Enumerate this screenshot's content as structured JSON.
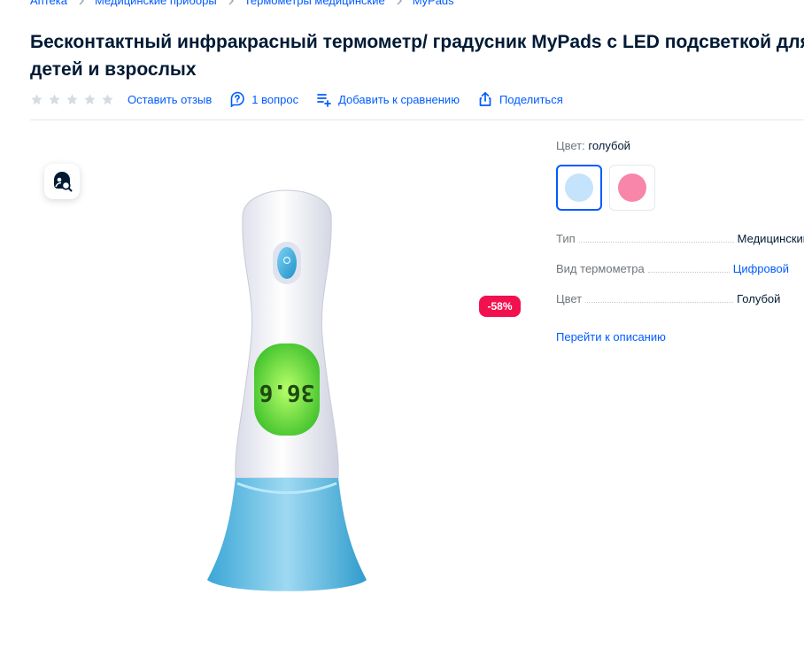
{
  "breadcrumbs": [
    "Аптека",
    "Медицинские приборы",
    "Термометры медицинские",
    "MyPads"
  ],
  "title": "Бесконтактный инфракрасный термометр/ градусник MyPads с LED подсветкой для детей и взрослых",
  "rating": {
    "stars_filled": 0,
    "stars_total": 5
  },
  "actions": {
    "review": "Оставить отзыв",
    "questions": "1 вопрос",
    "compare": "Добавить к сравнению",
    "share": "Поделиться"
  },
  "gallery": {
    "discount": "-58%",
    "display_text": "36.6"
  },
  "color": {
    "label": "Цвет:",
    "value": "голубой",
    "options": [
      "#c5e3fb",
      "#f786aa"
    ]
  },
  "specs": [
    {
      "name": "Тип",
      "value": "Медицинский",
      "link": false
    },
    {
      "name": "Вид термометра",
      "value": "Цифровой",
      "link": true
    },
    {
      "name": "Цвет",
      "value": "Голубой",
      "link": false
    }
  ],
  "go_to_description": "Перейти к описанию",
  "colors": {
    "accent": "#005bff",
    "discount": "#f1114f",
    "text": "#001a34",
    "muted": "#70757a"
  }
}
